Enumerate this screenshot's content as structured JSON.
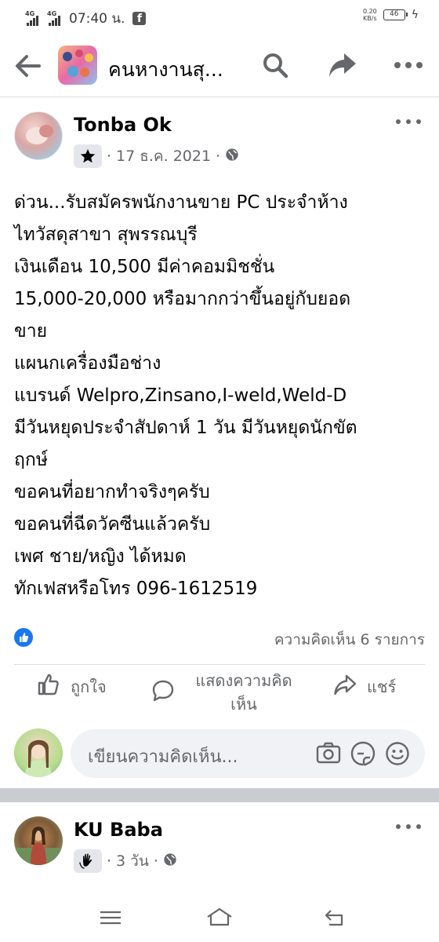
{
  "status_bar": {
    "network1": "4G",
    "network2": "4G",
    "time": "07:40 น.",
    "speed_value": "0.20",
    "speed_unit": "KB/s",
    "battery": "46"
  },
  "header": {
    "group_title": "คนหางานสุ...",
    "icons": [
      "back-arrow-icon",
      "search-icon",
      "share-icon",
      "more-icon"
    ]
  },
  "post": {
    "author": "Tonba Ok",
    "badge_icon": "star-icon",
    "date": "17 ธ.ค. 2021",
    "privacy_icon": "globe-icon",
    "lines": [
      "ด่วน...รับสมัครพนักงานขาย PC ประจำห้าง",
      "ไทวัสดุสาขา สุพรรณบุรี",
      "เงินเดือน 10,500 มีค่าคอมมิชชั่น",
      "15,000-20,000 หรือมากกว่าขึ้นอยู่กับยอด",
      "ขาย",
      "แผนกเครื่องมือช่าง",
      "แบรนด์ Welpro,Zinsano,I-weld,Weld-D",
      "มีวันหยุดประจำสัปดาห์ 1 วัน มีวันหยุดนักขัต",
      "ฤกษ์",
      "ขอคนที่อยากทำจริงๆครับ",
      "ขอคนที่ฉีดวัคซีนแล้วครับ",
      "เพศ ชาย/หญิง ได้หมด",
      "ทักเฟสหรือโทร 096-1612519"
    ],
    "reaction_icon": "like-reaction-icon",
    "comment_count": "ความคิดเห็น 6 รายการ",
    "actions": {
      "like": "ถูกใจ",
      "comment_line1": "แสดงความคิด",
      "comment_line2": "เห็น",
      "share": "แชร์"
    },
    "comment_placeholder": "เขียนความคิดเห็น..."
  },
  "post2": {
    "author": "KU Baba",
    "badge_icon": "wave-hand-icon",
    "date": "3 วัน",
    "privacy_icon": "globe-icon"
  },
  "colors": {
    "accent": "#1877f2",
    "text": "#050505",
    "muted": "#65676b",
    "divider": "#dadde1"
  }
}
